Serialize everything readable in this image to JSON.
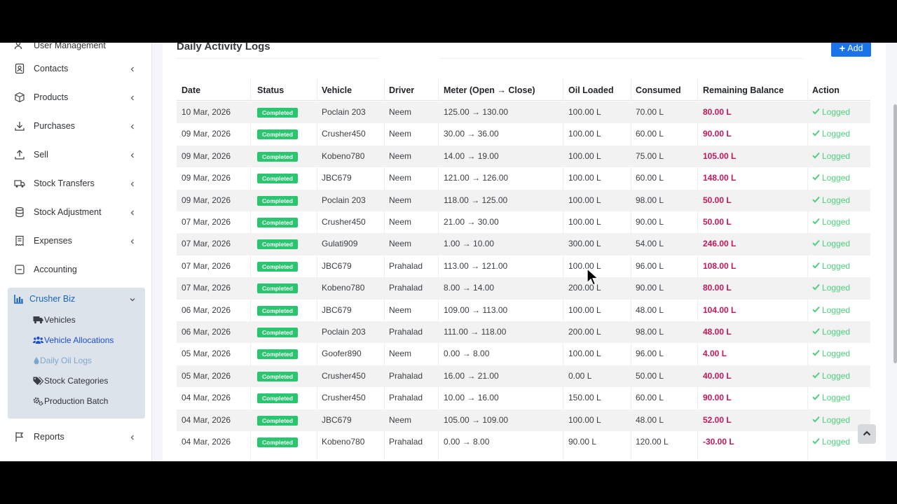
{
  "sidebar": {
    "items": [
      {
        "label": "User Management",
        "icon": "users-icon"
      },
      {
        "label": "Contacts",
        "icon": "contacts-icon"
      },
      {
        "label": "Products",
        "icon": "cube-icon"
      },
      {
        "label": "Purchases",
        "icon": "download-icon"
      },
      {
        "label": "Sell",
        "icon": "upload-icon"
      },
      {
        "label": "Stock Transfers",
        "icon": "truck-icon"
      },
      {
        "label": "Stock Adjustment",
        "icon": "database-icon"
      },
      {
        "label": "Expenses",
        "icon": "receipt-icon"
      },
      {
        "label": "Accounting",
        "icon": "accounting-icon"
      }
    ],
    "group": {
      "label": "Crusher Biz",
      "icon": "chart-icon",
      "items": [
        {
          "label": "Vehicles",
          "icon": "truck-icon"
        },
        {
          "label": "Vehicle Allocations",
          "icon": "users-icon"
        },
        {
          "label": "Daily Oil Logs",
          "icon": "drop-icon"
        },
        {
          "label": "Stock Categories",
          "icon": "tags-icon"
        },
        {
          "label": "Production Batch",
          "icon": "cogs-icon"
        }
      ]
    },
    "reports": {
      "label": "Reports",
      "icon": "flag-icon"
    }
  },
  "main": {
    "title": "Daily Activity Logs",
    "add_label": "Add",
    "columns": [
      "Date",
      "Status",
      "Vehicle",
      "Driver",
      "Meter (Open → Close)",
      "Oil Loaded",
      "Consumed",
      "Remaining Balance",
      "Action"
    ],
    "rows": [
      {
        "date": "10 Mar, 2026",
        "status": "Completed",
        "vehicle": "Poclain 203",
        "driver": "Neem",
        "meter": "125.00 → 130.00",
        "oil": "100.00 L",
        "consumed": "70.00 L",
        "balance": "80.00 L",
        "action": "Logged"
      },
      {
        "date": "09 Mar, 2026",
        "status": "Completed",
        "vehicle": "Crusher450",
        "driver": "Neem",
        "meter": "30.00 → 36.00",
        "oil": "100.00 L",
        "consumed": "60.00 L",
        "balance": "90.00 L",
        "action": "Logged"
      },
      {
        "date": "09 Mar, 2026",
        "status": "Completed",
        "vehicle": "Kobeno780",
        "driver": "Neem",
        "meter": "14.00 → 19.00",
        "oil": "100.00 L",
        "consumed": "75.00 L",
        "balance": "105.00 L",
        "action": "Logged"
      },
      {
        "date": "09 Mar, 2026",
        "status": "Completed",
        "vehicle": "JBC679",
        "driver": "Neem",
        "meter": "121.00 → 126.00",
        "oil": "100.00 L",
        "consumed": "60.00 L",
        "balance": "148.00 L",
        "action": "Logged"
      },
      {
        "date": "09 Mar, 2026",
        "status": "Completed",
        "vehicle": "Poclain 203",
        "driver": "Neem",
        "meter": "118.00 → 125.00",
        "oil": "100.00 L",
        "consumed": "98.00 L",
        "balance": "50.00 L",
        "action": "Logged"
      },
      {
        "date": "07 Mar, 2026",
        "status": "Completed",
        "vehicle": "Crusher450",
        "driver": "Neem",
        "meter": "21.00 → 30.00",
        "oil": "100.00 L",
        "consumed": "90.00 L",
        "balance": "50.00 L",
        "action": "Logged"
      },
      {
        "date": "07 Mar, 2026",
        "status": "Completed",
        "vehicle": "Gulati909",
        "driver": "Neem",
        "meter": "1.00 → 10.00",
        "oil": "300.00 L",
        "consumed": "54.00 L",
        "balance": "246.00 L",
        "action": "Logged"
      },
      {
        "date": "07 Mar, 2026",
        "status": "Completed",
        "vehicle": "JBC679",
        "driver": "Prahalad",
        "meter": "113.00 → 121.00",
        "oil": "100.00 L",
        "consumed": "96.00 L",
        "balance": "108.00 L",
        "action": "Logged"
      },
      {
        "date": "07 Mar, 2026",
        "status": "Completed",
        "vehicle": "Kobeno780",
        "driver": "Prahalad",
        "meter": "8.00 → 14.00",
        "oil": "200.00 L",
        "consumed": "90.00 L",
        "balance": "80.00 L",
        "action": "Logged"
      },
      {
        "date": "06 Mar, 2026",
        "status": "Completed",
        "vehicle": "JBC679",
        "driver": "Neem",
        "meter": "109.00 → 113.00",
        "oil": "100.00 L",
        "consumed": "48.00 L",
        "balance": "104.00 L",
        "action": "Logged"
      },
      {
        "date": "06 Mar, 2026",
        "status": "Completed",
        "vehicle": "Poclain 203",
        "driver": "Prahalad",
        "meter": "111.00 → 118.00",
        "oil": "200.00 L",
        "consumed": "98.00 L",
        "balance": "48.00 L",
        "action": "Logged"
      },
      {
        "date": "05 Mar, 2026",
        "status": "Completed",
        "vehicle": "Goofer890",
        "driver": "Neem",
        "meter": "0.00 → 8.00",
        "oil": "100.00 L",
        "consumed": "96.00 L",
        "balance": "4.00 L",
        "action": "Logged"
      },
      {
        "date": "05 Mar, 2026",
        "status": "Completed",
        "vehicle": "Crusher450",
        "driver": "Prahalad",
        "meter": "16.00 → 21.00",
        "oil": "0.00 L",
        "consumed": "50.00 L",
        "balance": "40.00 L",
        "action": "Logged"
      },
      {
        "date": "04 Mar, 2026",
        "status": "Completed",
        "vehicle": "Crusher450",
        "driver": "Prahalad",
        "meter": "10.00 → 16.00",
        "oil": "150.00 L",
        "consumed": "60.00 L",
        "balance": "90.00 L",
        "action": "Logged"
      },
      {
        "date": "04 Mar, 2026",
        "status": "Completed",
        "vehicle": "JBC679",
        "driver": "Neem",
        "meter": "105.00 → 109.00",
        "oil": "100.00 L",
        "consumed": "48.00 L",
        "balance": "52.00 L",
        "action": "Logged"
      },
      {
        "date": "04 Mar, 2026",
        "status": "Completed",
        "vehicle": "Kobeno780",
        "driver": "Prahalad",
        "meter": "0.00 → 8.00",
        "oil": "90.00 L",
        "consumed": "120.00 L",
        "balance": "-30.00 L",
        "action": "Logged"
      }
    ]
  },
  "colors": {
    "accent": "#1a73e8",
    "badge": "#28c76f",
    "balance": "#c2185b",
    "logged": "#4cd07d",
    "active": "#1a4fd1"
  }
}
